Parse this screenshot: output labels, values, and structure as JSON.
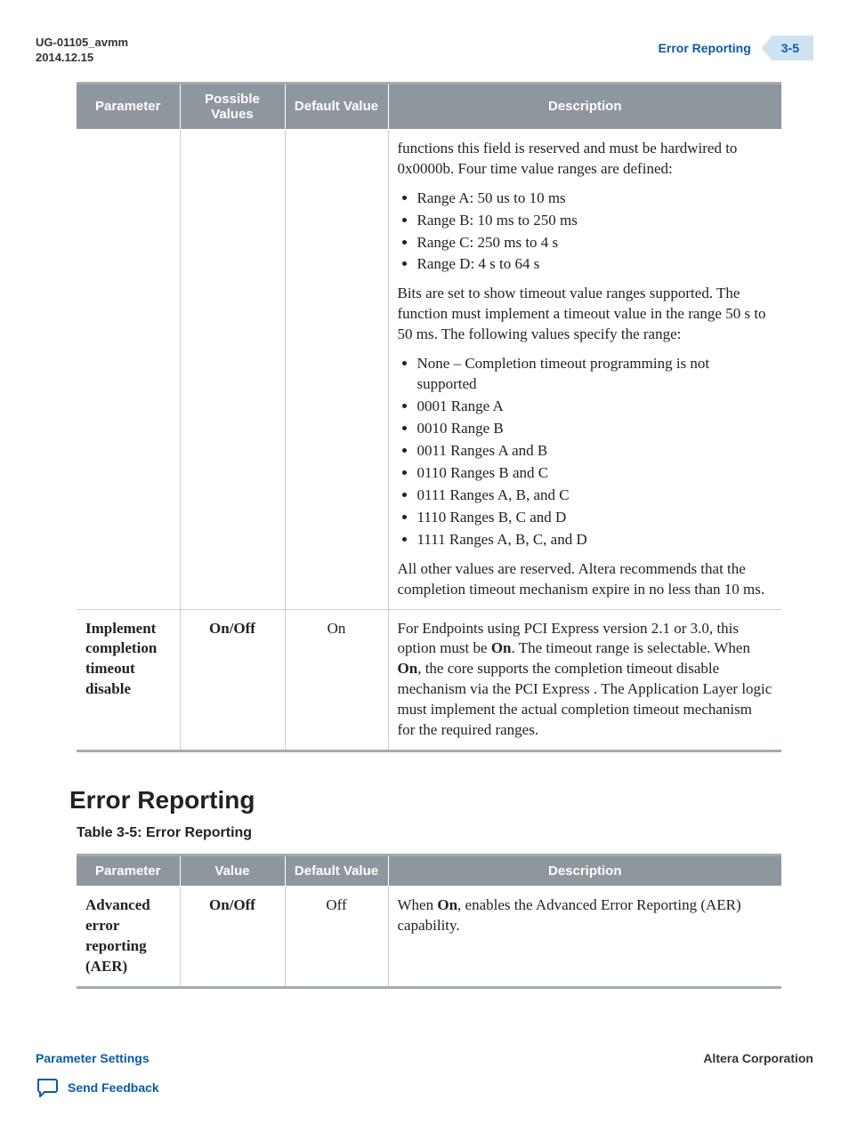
{
  "header": {
    "doc_id": "UG-01105_avmm",
    "date": "2014.12.15",
    "section_link": "Error Reporting",
    "page_num": "3-5"
  },
  "table1": {
    "headers": [
      "Parameter",
      "Possible Values",
      "Default Value",
      "Description"
    ],
    "rows": [
      {
        "param": "",
        "values": "",
        "default": "",
        "desc": {
          "p1": "functions this field is reserved and must be hardwired to 0x0000b. Four time value ranges are defined:",
          "list1": [
            "Range A: 50 us to 10 ms",
            "Range B: 10 ms to 250 ms",
            "Range C: 250 ms to 4 s",
            "Range D: 4 s to 64 s"
          ],
          "p2": "Bits are set to show timeout value ranges supported. The function must implement a timeout value in the range 50 s to 50 ms. The following values specify the range:",
          "list2": [
            "None – Completion timeout programming is not supported",
            "0001 Range A",
            "0010 Range B",
            "0011 Ranges A and B",
            "0110 Ranges B and C",
            "0111 Ranges A, B, and C",
            "1110 Ranges B, C and D",
            "1111 Ranges A, B, C, and D"
          ],
          "p3": "All other values are reserved. Altera recommends that the completion timeout mechanism expire in no less than 10 ms."
        }
      },
      {
        "param": "Implement completion timeout disable",
        "values": "On/Off",
        "default": "On",
        "desc": {
          "pre1": "For Endpoints using PCI Express version 2.1 or 3.0, this option must be ",
          "b1": "On",
          "mid1": ". The timeout range is selectable. When ",
          "b2": "On",
          "mid2": ", the core supports the completion timeout disable mechanism via the PCI Express ",
          "post": ". The Application Layer logic must implement the actual completion timeout mechanism for the required ranges."
        }
      }
    ]
  },
  "section_heading": "Error Reporting",
  "table2_caption": "Table 3-5: Error Reporting",
  "table2": {
    "headers": [
      "Parameter",
      "Value",
      "Default Value",
      "Description"
    ],
    "rows": [
      {
        "param": "Advanced error reporting (AER)",
        "values": "On/Off",
        "default": "Off",
        "desc_pre": "When ",
        "desc_b": "On",
        "desc_post": ", enables the Advanced Error Reporting (AER) capability."
      }
    ]
  },
  "footer": {
    "left": "Parameter Settings",
    "right": "Altera Corporation",
    "feedback": "Send Feedback"
  }
}
